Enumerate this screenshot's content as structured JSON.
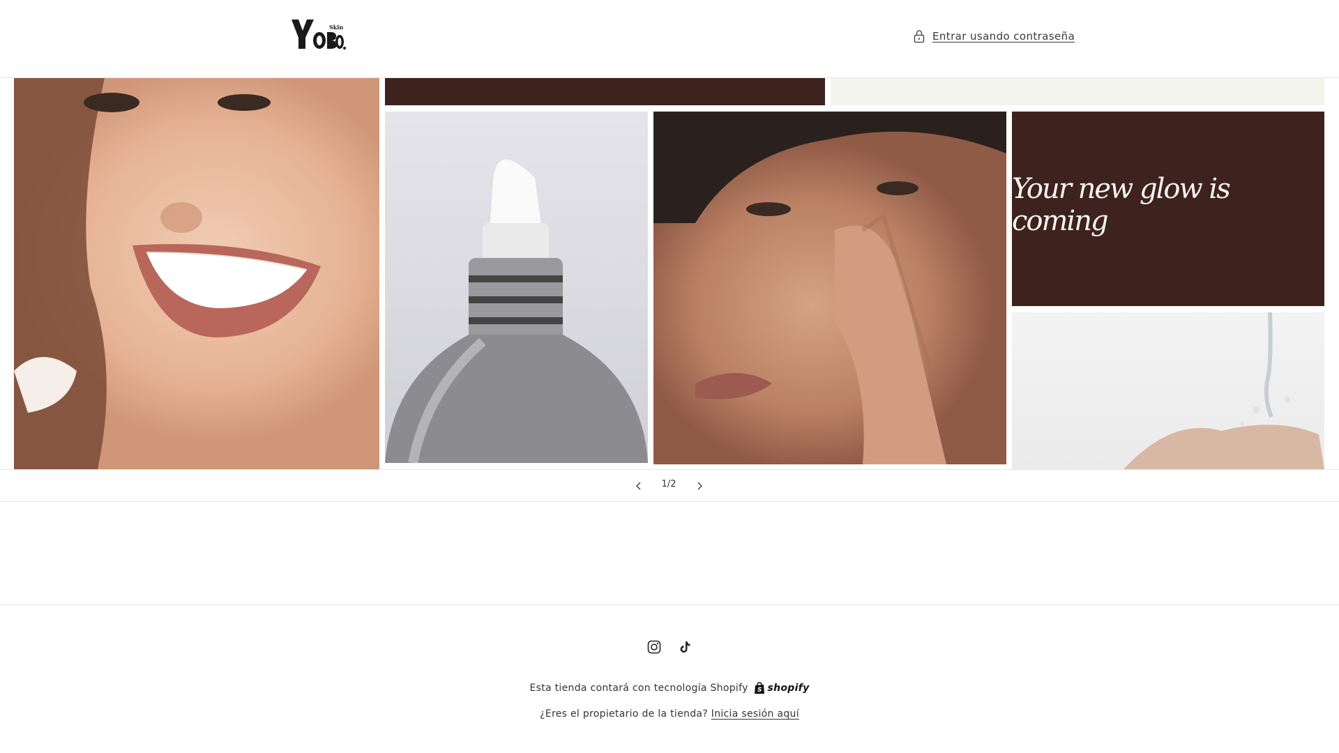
{
  "header": {
    "logo": {
      "main": "YOBO",
      "small": "Skin"
    },
    "login_link": {
      "label": "Entrar usando contraseña",
      "icon": "lock-icon"
    }
  },
  "slideshow": {
    "tagline": "Your new glow is coming",
    "counter": {
      "current": "1",
      "separator": "/",
      "total": "2"
    },
    "prev_icon": "chevron-left-icon",
    "next_icon": "chevron-right-icon"
  },
  "footer": {
    "social_icons": [
      "instagram-icon",
      "tiktok-icon"
    ],
    "powered_by": "Esta tienda contará con tecnología Shopify",
    "shopify_logo": "shopify",
    "owner_question": "¿Eres el propietario de la tienda?",
    "owner_link": "Inicia sesión aquí"
  },
  "colors": {
    "brand_brown": "#3d221d",
    "cream": "#f4f4ef",
    "text": "#333333"
  }
}
